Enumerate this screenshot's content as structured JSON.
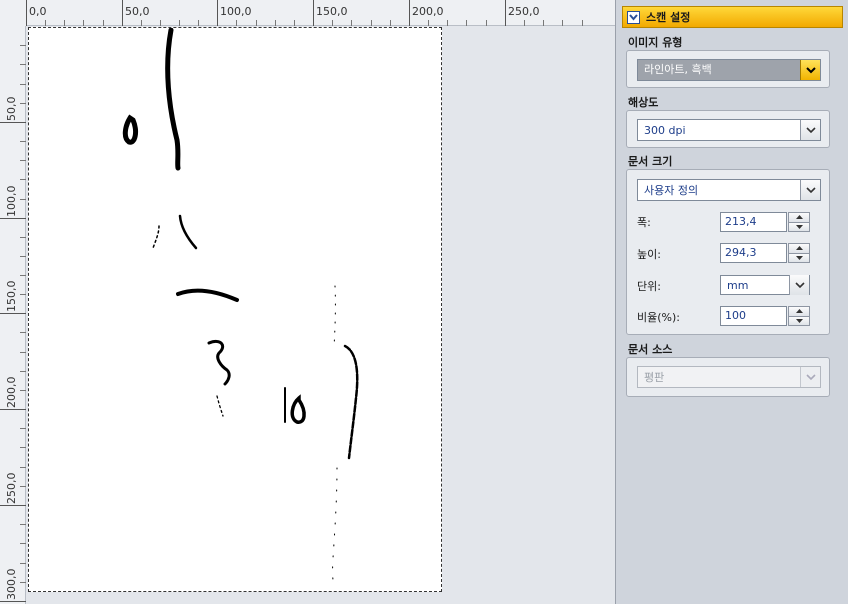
{
  "ruler": {
    "top_labels": [
      "0,0",
      "50,0",
      "100,0",
      "150,0",
      "200,0",
      "250,0"
    ],
    "left_labels": [
      "50,0",
      "100,0",
      "150,0",
      "200,0",
      "250,0",
      "300,0"
    ]
  },
  "panel": {
    "title": "스캔 설정",
    "image_type": {
      "label": "이미지 유형",
      "value": "라인아트, 흑백"
    },
    "resolution": {
      "label": "해상도",
      "value": "300 dpi"
    },
    "document_size": {
      "label": "문서 크기",
      "preset": "사용자 정의",
      "width_label": "폭:",
      "width_value": "213,4",
      "height_label": "높이:",
      "height_value": "294,3",
      "unit_label": "단위:",
      "unit_value": "mm",
      "scale_label": "비율(%):",
      "scale_value": "100"
    },
    "document_source": {
      "label": "문서 소스",
      "value": "평판"
    }
  },
  "colors": {
    "header_yellow": "#f2a900",
    "panel_bg": "#cfd4dc",
    "value_text": "#1d3d8a"
  },
  "icons": {
    "collapse": "checkbox-chevron-icon",
    "dropdown": "chevron-down-icon",
    "spin_up": "triangle-up-icon",
    "spin_down": "triangle-down-icon"
  }
}
